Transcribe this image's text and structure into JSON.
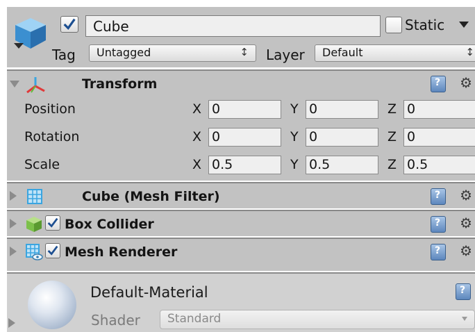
{
  "object": {
    "name": "Cube",
    "static_label": "Static",
    "tag_label": "Tag",
    "tag_value": "Untagged",
    "layer_label": "Layer",
    "layer_value": "Default",
    "dropdown_arrows": "↕"
  },
  "transform": {
    "title": "Transform",
    "rows": [
      {
        "label": "Position",
        "x": "0",
        "y": "0",
        "z": "0"
      },
      {
        "label": "Rotation",
        "x": "0",
        "y": "0",
        "z": "0"
      },
      {
        "label": "Scale",
        "x": "0.5",
        "y": "0.5",
        "z": "0.5"
      }
    ],
    "axis_x": "X",
    "axis_y": "Y",
    "axis_z": "Z"
  },
  "components": {
    "mesh_filter": "Cube (Mesh Filter)",
    "box_collider": "Box Collider",
    "mesh_renderer": "Mesh Renderer"
  },
  "material": {
    "name": "Default-Material",
    "shader_label": "Shader",
    "shader_value": "Standard"
  },
  "icons": {
    "gear": "⚙",
    "help": "help-icon",
    "cube": "cube-icon"
  },
  "colors": {
    "panel": "#c2c2c2",
    "cube_blue": "#4aa3df",
    "collider_green": "#7cc04a"
  }
}
